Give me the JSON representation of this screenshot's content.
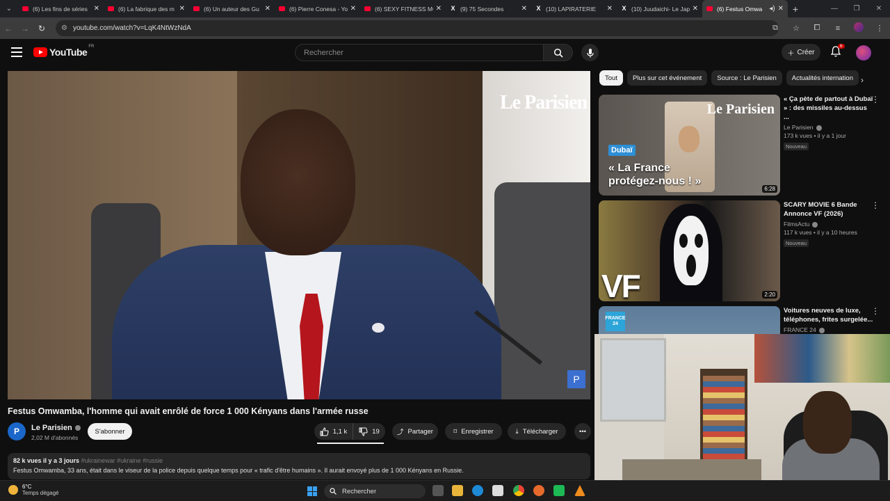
{
  "browser": {
    "tabs": [
      {
        "title": "(6) Les fins de séries",
        "icon": "youtube-icon"
      },
      {
        "title": "(6) La fabrique des m",
        "icon": "youtube-icon"
      },
      {
        "title": "(6) Un auteur des Gu",
        "icon": "youtube-icon"
      },
      {
        "title": "(6) Pierre Conesa - Yo",
        "icon": "youtube-icon"
      },
      {
        "title": "(6) SEXY FITNESS MC",
        "icon": "youtube-icon"
      },
      {
        "title": "(9) 75 Secondes",
        "icon": "x-icon"
      },
      {
        "title": "(10) LAPIRATERIE",
        "icon": "x-icon"
      },
      {
        "title": "(10) Juudaichi- Le Jap",
        "icon": "x-icon"
      },
      {
        "title": "(6) Festus Omwa",
        "icon": "youtube-icon",
        "active": true
      }
    ],
    "url": "youtube.com/watch?v=LqK4NtWzNdA"
  },
  "youtube": {
    "logo_text": "YouTube",
    "logo_region": "FR",
    "search_placeholder": "Rechercher",
    "create_label": "Créer",
    "notif_count": "6"
  },
  "video": {
    "overlay_logo": "Le Parisien",
    "corner_badge": "P",
    "title": "Festus Omwamba, l'homme qui avait enrôlé de force 1 000 Kényans dans l'armée russe",
    "channel": "Le Parisien",
    "channel_initial": "P",
    "subscribers": "2,02 M d'abonnés",
    "subscribe_label": "S'abonner",
    "likes": "1,1 k",
    "dislikes": "19",
    "share_label": "Partager",
    "save_label": "Enregistrer",
    "download_label": "Télécharger",
    "like_ratio": 0.98
  },
  "description": {
    "meta": "82 k vues  il y a 3 jours",
    "tags": "#ukrainewar #ukraine #russie",
    "text": "Festus Omwamba, 33 ans, était dans le viseur de la police depuis quelque temps pour « trafic d'être humains ». Il aurait envoyé plus de 1 000 Kényans en Russie."
  },
  "chips": [
    "Tout",
    "Plus sur cet événement",
    "Source : Le Parisien",
    "Actualités internation"
  ],
  "recommendations": [
    {
      "title": "« Ça pète de partout à Dubaï » : des missiles au-dessus ...",
      "channel": "Le Parisien",
      "meta": "173 k vues • il y a 1 jour",
      "badge": "Nouveau",
      "duration": "6:28",
      "thumb_logo": "Le Parisien",
      "thumb_tag": "Dubaï",
      "thumb_quote": "« La France protégez-nous ! »"
    },
    {
      "title": "SCARY MOVIE 6 Bande Annonce VF (2026)",
      "channel": "FilmsActu",
      "meta": "117 k vues • il y a 10 heures",
      "badge": "Nouveau",
      "duration": "2:20",
      "thumb_text": "VF"
    },
    {
      "title": "Voitures neuves de luxe, téléphones, frites surgelée...",
      "channel": "FRANCE 24",
      "thumb_logo": "FRANCE 24"
    }
  ],
  "taskbar": {
    "temp": "6°C",
    "weather": "Temps dégagé",
    "search_label": "Rechercher"
  }
}
